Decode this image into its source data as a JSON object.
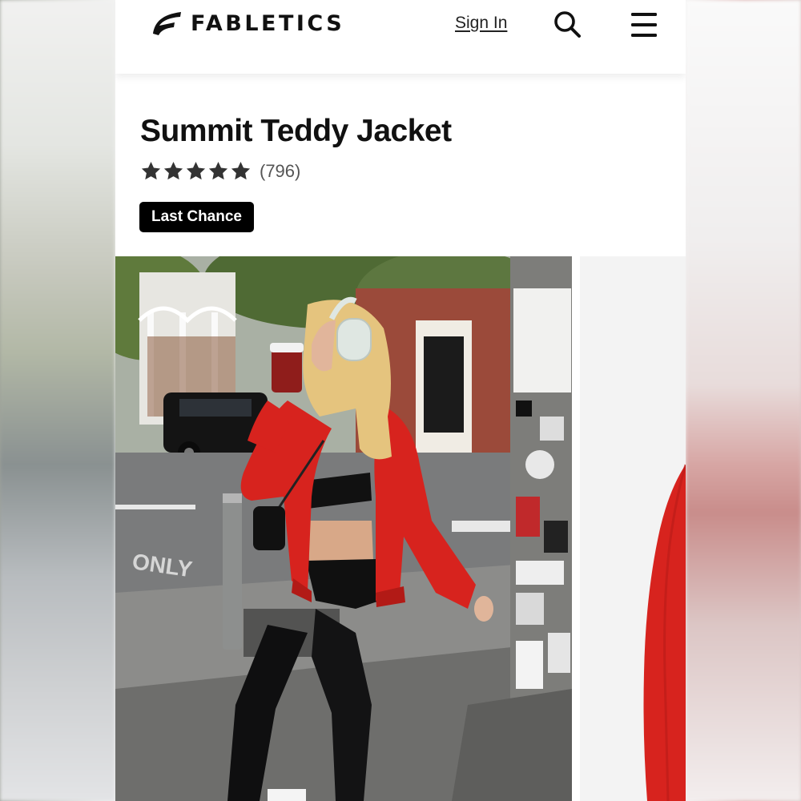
{
  "header": {
    "brand": "FABLETICS",
    "sign_in": "Sign In"
  },
  "product": {
    "title": "Summit Teddy Jacket",
    "rating_stars": 5,
    "review_count": "(796)",
    "badge": "Last Chance"
  },
  "icons": {
    "brand": "fabletics-logo-icon",
    "search": "search-icon",
    "menu": "hamburger-menu-icon",
    "star": "star-icon"
  },
  "colors": {
    "badge_background": "#000000",
    "jacket_red": "#d7231e",
    "text": "#111111"
  }
}
